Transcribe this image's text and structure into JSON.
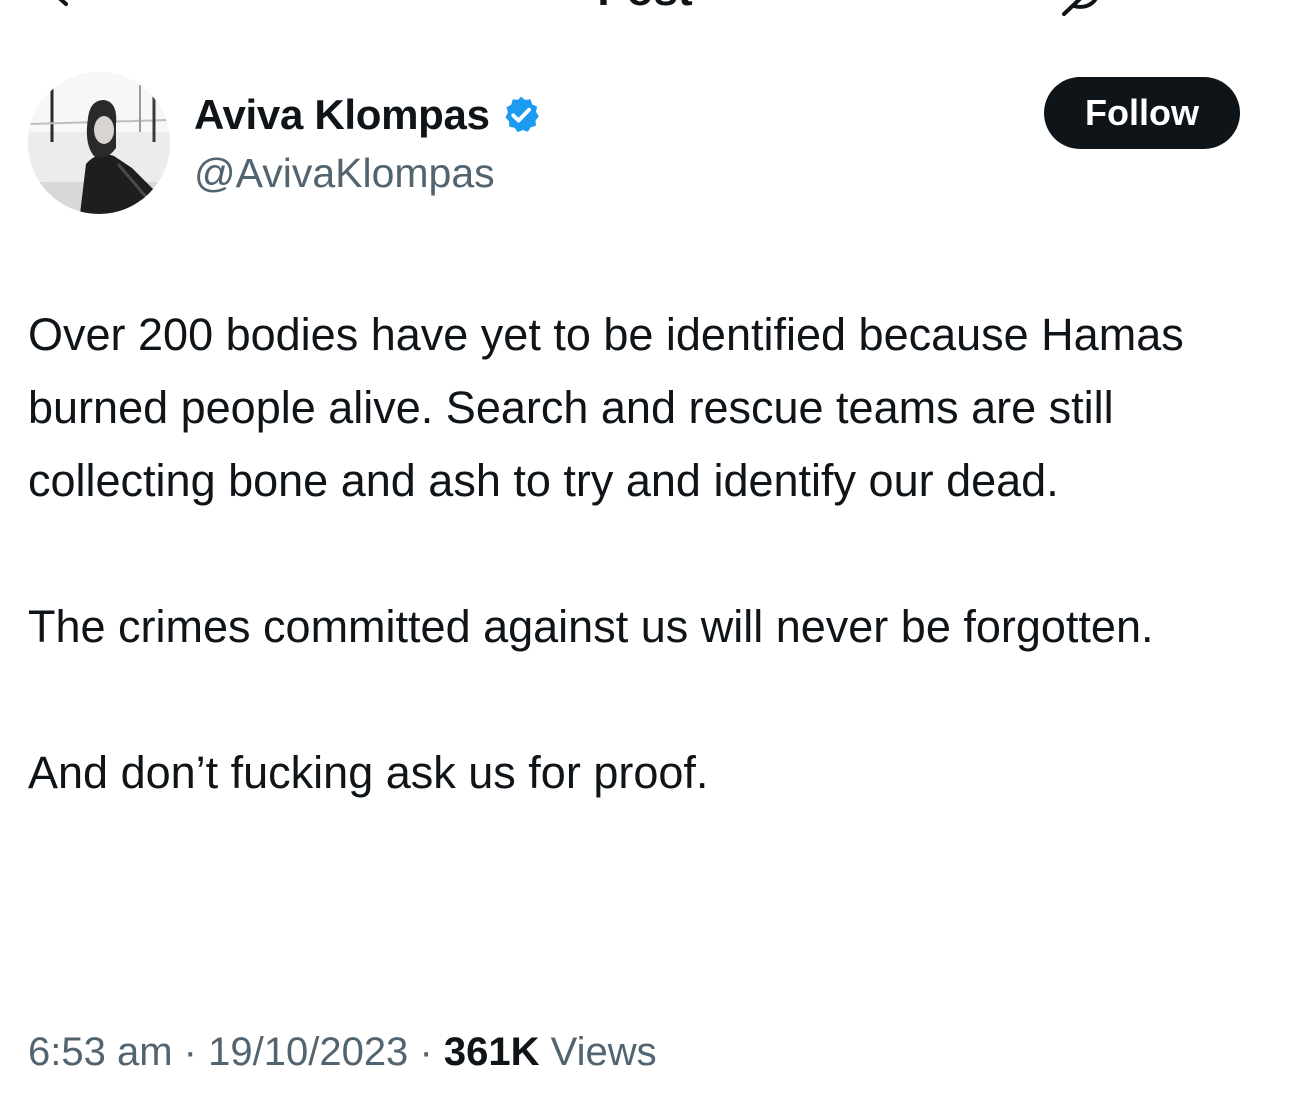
{
  "nav": {
    "title": "Post"
  },
  "tweet": {
    "author": {
      "display_name": "Aviva Klompas",
      "handle": "@AvivaKlompas",
      "verified": true
    },
    "follow_label": "Follow",
    "paragraphs": [
      "Over 200 bodies have yet to be identified because Hamas burned people alive. Search and rescue teams are still collecting bone and ash to try and identify our dead.",
      "The crimes committed against us will never be forgotten.",
      "And don’t fucking ask us for proof."
    ],
    "time": "6:53 am",
    "separator": "·",
    "date": "19/10/2023",
    "views_count": "361K",
    "views_label": "Views"
  },
  "colors": {
    "text": "#0f1419",
    "secondary": "#536471",
    "verified": "#1d9bf0",
    "follow_bg": "#0f1419"
  },
  "icons": {
    "back": "arrow-left-icon",
    "grok": "grok-icon",
    "verified": "verified-badge-icon"
  }
}
